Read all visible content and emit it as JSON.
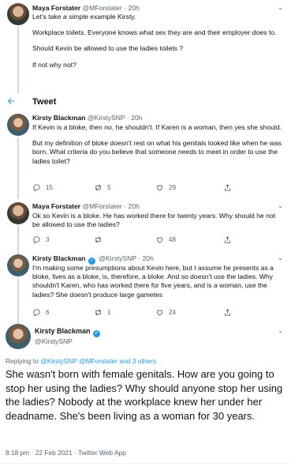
{
  "tweets": [
    {
      "name": "Maya Forstater",
      "handle": "@MForstater",
      "time": "20h",
      "paragraphs": [
        "Let's take a simple example Kirsty.",
        "Workplace toilets. Everyone knows what sex they are and their employer does to.",
        "Should Kevin be allowed to use the ladies toilets ?",
        "If not why not?"
      ]
    },
    {
      "name": "Kirsty Blackman",
      "handle": "@KirstySNP",
      "time": "20h",
      "paragraphs": [
        "If Kevin is a bloke, then no, he shouldn't. If Karen is a woman, then yes she should.",
        "But my definition of bloke doesn't rest on what his genitals looked like when he was born. What criteria do you believe that someone needs to meet in order to use the ladies toilet?"
      ],
      "replies": "15",
      "retweets": "5",
      "likes": "29"
    },
    {
      "name": "Maya Forstater",
      "handle": "@MForstater",
      "time": "20h",
      "paragraphs": [
        "Ok so Kevin is a bloke. He has worked there for twenty years. Why should he not be allowed to use the ladies?"
      ],
      "replies": "3",
      "retweets": "",
      "likes": "48"
    },
    {
      "name": "Kirsty Blackman",
      "handle": "@KirstySNP",
      "time": "20h",
      "paragraphs": [
        "I'm making some presumptions about Kevin here, but I assume he presents as a bloke, lives as a bloke, is, therefore, a bloke. And so doesn't use the ladies. Why shouldn't Karen, who has worked there for five years, and is a woman, use the ladies? She doesn't produce large gametes"
      ],
      "replies": "6",
      "retweets": "1",
      "likes": "24"
    }
  ],
  "header": {
    "back_icon": "arrow-left-icon",
    "title": "Tweet"
  },
  "main": {
    "name": "Kirsty Blackman",
    "handle": "@KirstySNP",
    "replying_prefix": "Replying to",
    "replying_users": "@KirstySNP @MForstater",
    "replying_suffix": "and 3 others",
    "text": "She wasn't born with female genitals. How are you going to stop her using the ladies? Why should anyone stop her using the ladies? Nobody at the workplace knew her under her deadname. She's been living as a woman for 30 years.",
    "meta": "8:18 pm · 22 Feb 2021 · Twitter Web App"
  },
  "colors": {
    "accent": "#1d9bf0",
    "muted": "#536471",
    "text": "#0f1419"
  }
}
